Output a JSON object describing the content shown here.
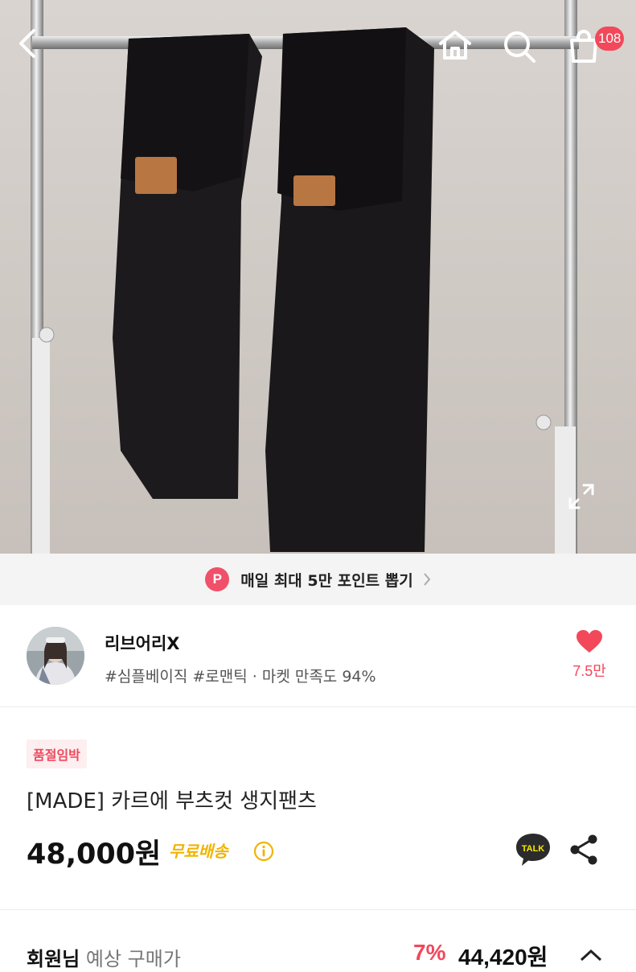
{
  "header": {
    "back_icon": "chevron-left-icon",
    "home_icon": "home-icon",
    "search_icon": "search-icon",
    "cart_icon": "shopping-bag-icon",
    "cart_count": "108",
    "expand_icon": "fullscreen-icon"
  },
  "promo": {
    "badge": "P",
    "text": "매일 최대 5만 포인트 뽑기"
  },
  "seller": {
    "name": "리브어리X",
    "tags": "#심플베이직 #로맨틱 · 마켓 만족도 94%",
    "like_count": "7.5만"
  },
  "product": {
    "stock_badge": "품절임박",
    "title": "[MADE] 카르에 부츠컷 생지팬츠",
    "price": "48,000원",
    "shipping": "무료배송",
    "talk_label": "TALK"
  },
  "member_price": {
    "label_bold": "회원님",
    "label": "예상 구매가",
    "discount": "7%",
    "price": "44,420원"
  },
  "colors": {
    "accent": "#f2485a",
    "shipping": "#f0b400",
    "talk": "#2b2b2b"
  }
}
